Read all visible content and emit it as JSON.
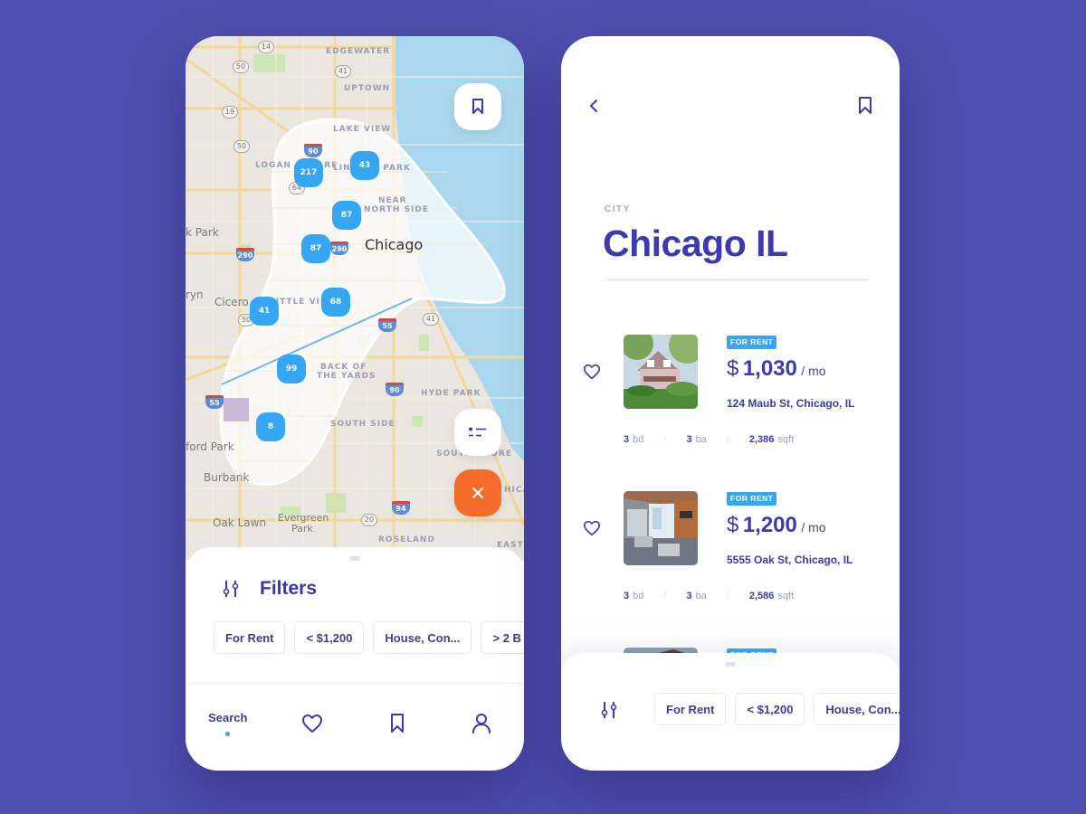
{
  "colors": {
    "background": "#4e4fae",
    "primary": "#3c3aae",
    "cluster": "#35a6f3",
    "close_button": "#f46b2a",
    "badge": "#35a6f3"
  },
  "map_screen": {
    "map": {
      "labels": {
        "edgewater": "EDGEWATER",
        "uptown": "UPTOWN",
        "lake_view": "LAKE VIEW",
        "logan_square": "LOGAN SQUARE",
        "lincoln_park": "LINCOLN PARK",
        "near_north_side_1": "NEAR",
        "near_north_side_2": "NORTH SIDE",
        "chicago": "Chicago",
        "park": "k Park",
        "ryn": "ryn",
        "cicero": "Cicero",
        "little_village": "LITTLE VILLA",
        "back_of_1": "BACK OF",
        "back_of_2": "THE YARDS",
        "hyde_park": "HYDE PARK",
        "south_side": "SOUTH SIDE",
        "south_shore": "SOUTH SHORE",
        "ford_park": "ford Park",
        "burbank": "Burbank",
        "oak_lawn": "Oak Lawn",
        "evergreen_1": "Evergreen",
        "evergreen_2": "Park",
        "roseland": "ROSELAND",
        "east": "EAST",
        "chicago_edge": "HICAG"
      },
      "shields": {
        "us14": "14",
        "us50a": "50",
        "us41a": "41",
        "us19": "19",
        "us50b": "50",
        "us64": "64",
        "us50c": "50",
        "us41b": "41",
        "us20": "20"
      },
      "interstates": {
        "i90a": "90",
        "i290a": "290",
        "i290b": "290",
        "i55a": "55",
        "i55b": "55",
        "i90b": "90",
        "i94": "94"
      },
      "clusters": [
        "217",
        "43",
        "87",
        "87",
        "68",
        "41",
        "99",
        "8"
      ]
    },
    "buttons": {
      "bookmark_icon": "bookmark-icon",
      "list_icon": "list-view-icon",
      "close_label": "×"
    },
    "filters": {
      "title": "Filters",
      "chips": [
        "For Rent",
        "< $1,200",
        "House, Con...",
        "> 2 B"
      ]
    },
    "tabbar": {
      "search_label": "Search",
      "items": [
        "search",
        "favorites",
        "saved",
        "profile"
      ]
    }
  },
  "list_screen": {
    "caption": "CITY",
    "title": "Chicago IL",
    "listings": [
      {
        "badge": "FOR RENT",
        "currency": "$",
        "price": "1,030",
        "period": "/ mo",
        "address": "124 Maub St, Chicago, IL",
        "beds": "3",
        "beds_unit": "bd",
        "baths": "3",
        "baths_unit": "ba",
        "area": "2,386",
        "area_unit": "sqft"
      },
      {
        "badge": "FOR RENT",
        "currency": "$",
        "price": "1,200",
        "period": "/ mo",
        "address": "5555 Oak St, Chicago, IL",
        "beds": "3",
        "beds_unit": "bd",
        "baths": "3",
        "baths_unit": "ba",
        "area": "2,586",
        "area_unit": "sqft"
      },
      {
        "badge": "FOR RENT"
      }
    ],
    "filter_chips": [
      "For Rent",
      "< $1,200",
      "House, Con..."
    ]
  }
}
